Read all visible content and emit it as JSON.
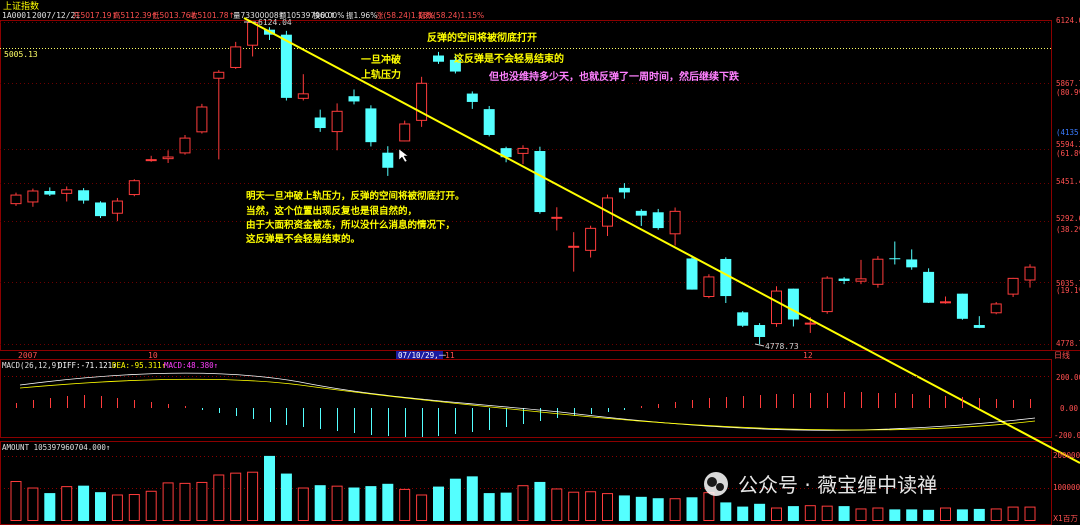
{
  "header": {
    "name": "上证指数",
    "code": "1A0001",
    "date": "2007/12/21",
    "items": [
      {
        "text": "开5017.19↑",
        "color": "#ff5050"
      },
      {
        "text": "高5112.39↑",
        "color": "#ff5050"
      },
      {
        "text": "低5013.76↑",
        "color": "#ff5050"
      },
      {
        "text": "收5101.78↑",
        "color": "#ff5050"
      },
      {
        "text": "量73300008↑",
        "color": "#e0e0e0"
      },
      {
        "text": "额105397960↑",
        "color": "#e0e0e0"
      },
      {
        "text": "换0.00%",
        "color": "#e0e0e0"
      },
      {
        "text": "振1.96%",
        "color": "#e0e0e0"
      },
      {
        "text": "涨(58.24)1.15%",
        "color": "#ff5050"
      },
      {
        "text": "指数(58.24)1.15%",
        "color": "#ff5050"
      }
    ]
  },
  "price_panel": {
    "y_labels": [
      {
        "text": "6124.0",
        "color": "#ff5050"
      },
      {
        "text": "5867.7",
        "color": "#ff5050"
      },
      {
        "text": "(80.9%)",
        "color": "#ff5050"
      },
      {
        "text": "(4135)",
        "color": "#3a7cff"
      },
      {
        "text": "5594.36",
        "color": "#ff5050"
      },
      {
        "text": "(61.8%)",
        "color": "#ff5050"
      },
      {
        "text": "5451.4",
        "color": "#ff5050"
      },
      {
        "text": "5292.6",
        "color": "#ff5050"
      },
      {
        "text": "(38.2%)",
        "color": "#ff5050"
      },
      {
        "text": "5035.7",
        "color": "#ff5050"
      },
      {
        "text": "(19.1%)",
        "color": "#ff5050"
      },
      {
        "text": "4778.7",
        "color": "#ff5050"
      }
    ],
    "ref_line_label": "5005.13",
    "high_label": "6124.04",
    "low_label": "4778.73",
    "x_labels": [
      "2007",
      "10",
      "07/10/29,一",
      "11",
      "12"
    ],
    "period_label": "日线"
  },
  "annotations": {
    "a1": "一旦冲破",
    "a2": "上轨压力",
    "a3": "反弹的空间将被彻底打开",
    "a4": "这反弹是不会轻易结束的",
    "a5": "但也没维持多少天，也就反弹了一周时间，然后继续下跌",
    "b1": "明天一旦冲破上轨压力，反弹的空间将被彻底打开。",
    "b2": "当然，这个位置出现反复也是很自然的，",
    "b3": "由于大面积资金被冻，所以没什么消息的情况下，",
    "b4": "这反弹是不会轻易结束的。"
  },
  "macd_panel": {
    "label": "MACD(26,12,9)",
    "diff": "DIFF:-71.121↑",
    "dea": "DEA:-95.311↑",
    "macd": "MACD:48.380↑",
    "y_labels": [
      "200.00",
      "0.00",
      "-200.00"
    ]
  },
  "volume_panel": {
    "label": "AMOUNT 105397960704.000↑",
    "y_labels": [
      "200000",
      "100000",
      "X1百万"
    ]
  },
  "watermark": "公众号 · 薇宝缠中读禅",
  "chart_data": {
    "type": "candlestick",
    "title": "上证指数",
    "candles": [
      {
        "o": 5363,
        "c": 5403,
        "h": 5411,
        "l": 5356
      },
      {
        "o": 5370,
        "c": 5420,
        "h": 5428,
        "l": 5352
      },
      {
        "o": 5418,
        "c": 5403,
        "h": 5433,
        "l": 5397
      },
      {
        "o": 5406,
        "c": 5425,
        "h": 5437,
        "l": 5374
      },
      {
        "o": 5421,
        "c": 5378,
        "h": 5430,
        "l": 5365
      },
      {
        "o": 5370,
        "c": 5313,
        "h": 5375,
        "l": 5305
      },
      {
        "o": 5323,
        "c": 5378,
        "h": 5389,
        "l": 5292
      },
      {
        "o": 5401,
        "c": 5463,
        "h": 5467,
        "l": 5396
      },
      {
        "o": 5551,
        "c": 5551,
        "h": 5565,
        "l": 5540
      },
      {
        "o": 5551,
        "c": 5562,
        "h": 5588,
        "l": 5535
      },
      {
        "o": 5575,
        "c": 5641,
        "h": 5652,
        "l": 5570
      },
      {
        "o": 5663,
        "c": 5771,
        "h": 5782,
        "l": 5658
      },
      {
        "o": 5887,
        "c": 5916,
        "h": 5923,
        "l": 5550
      },
      {
        "o": 5932,
        "c": 6022,
        "h": 6041,
        "l": 5928
      },
      {
        "o": 6025,
        "c": 6124,
        "h": 6124,
        "l": 5980
      },
      {
        "o": 6092,
        "c": 6071,
        "h": 6102,
        "l": 6049
      },
      {
        "o": 6071,
        "c": 5807,
        "h": 6087,
        "l": 5796
      },
      {
        "o": 5803,
        "c": 5826,
        "h": 5906,
        "l": 5796
      },
      {
        "o": 5725,
        "c": 5681,
        "h": 5758,
        "l": 5665
      },
      {
        "o": 5664,
        "c": 5753,
        "h": 5784,
        "l": 5588
      },
      {
        "o": 5814,
        "c": 5792,
        "h": 5842,
        "l": 5780
      },
      {
        "o": 5763,
        "c": 5622,
        "h": 5776,
        "l": 5604
      },
      {
        "o": 5578,
        "c": 5515,
        "h": 5605,
        "l": 5481
      },
      {
        "o": 5625,
        "c": 5700,
        "h": 5712,
        "l": 5625
      },
      {
        "o": 5711,
        "c": 5870,
        "h": 5895,
        "l": 5686
      },
      {
        "o": 5984,
        "c": 5958,
        "h": 5999,
        "l": 5949
      },
      {
        "o": 5966,
        "c": 5917,
        "h": 5984,
        "l": 5909
      },
      {
        "o": 5825,
        "c": 5790,
        "h": 5834,
        "l": 5761
      },
      {
        "o": 5760,
        "c": 5652,
        "h": 5773,
        "l": 5646
      },
      {
        "o": 5597,
        "c": 5559,
        "h": 5603,
        "l": 5538
      },
      {
        "o": 5573,
        "c": 5598,
        "h": 5609,
        "l": 5530
      },
      {
        "o": 5585,
        "c": 5330,
        "h": 5603,
        "l": 5323
      },
      {
        "o": 5310,
        "c": 5310,
        "h": 5350,
        "l": 5253
      },
      {
        "o": 5189,
        "c": 5189,
        "h": 5246,
        "l": 5081
      },
      {
        "o": 5168,
        "c": 5264,
        "h": 5273,
        "l": 5140
      },
      {
        "o": 5269,
        "c": 5391,
        "h": 5403,
        "l": 5230
      },
      {
        "o": 5431,
        "c": 5412,
        "h": 5451,
        "l": 5386
      },
      {
        "o": 5335,
        "c": 5315,
        "h": 5342,
        "l": 5272
      },
      {
        "o": 5329,
        "c": 5263,
        "h": 5343,
        "l": 5256
      },
      {
        "o": 5237,
        "c": 5335,
        "h": 5349,
        "l": 5190
      },
      {
        "o": 5136,
        "c": 5006,
        "h": 5149,
        "l": 5006
      },
      {
        "o": 4975,
        "c": 5061,
        "h": 5070,
        "l": 4970
      },
      {
        "o": 5134,
        "c": 4979,
        "h": 5141,
        "l": 4950
      },
      {
        "o": 4911,
        "c": 4855,
        "h": 4916,
        "l": 4850
      },
      {
        "o": 4858,
        "c": 4808,
        "h": 4866,
        "l": 4778
      },
      {
        "o": 4862,
        "c": 5002,
        "h": 5020,
        "l": 4850
      },
      {
        "o": 5010,
        "c": 4881,
        "h": 5010,
        "l": 4852
      },
      {
        "o": 4865,
        "c": 4868,
        "h": 4891,
        "l": 4825
      },
      {
        "o": 4912,
        "c": 5056,
        "h": 5062,
        "l": 4905
      },
      {
        "o": 5052,
        "c": 5042,
        "h": 5058,
        "l": 5029
      },
      {
        "o": 5039,
        "c": 5053,
        "h": 5130,
        "l": 5029
      },
      {
        "o": 5026,
        "c": 5135,
        "h": 5146,
        "l": 5014
      },
      {
        "o": 5137,
        "c": 5133,
        "h": 5207,
        "l": 5111
      },
      {
        "o": 5132,
        "c": 5099,
        "h": 5174,
        "l": 5089
      },
      {
        "o": 5080,
        "c": 4951,
        "h": 5095,
        "l": 4950
      },
      {
        "o": 4956,
        "c": 4957,
        "h": 4977,
        "l": 4947
      },
      {
        "o": 4989,
        "c": 4884,
        "h": 4989,
        "l": 4880
      },
      {
        "o": 4858,
        "c": 4846,
        "h": 4895,
        "l": 4845
      },
      {
        "o": 4907,
        "c": 4948,
        "h": 4954,
        "l": 4903
      },
      {
        "o": 4985,
        "c": 5055,
        "h": 5055,
        "l": 4975
      },
      {
        "o": 5044,
        "c": 5102,
        "h": 5112,
        "l": 5014
      }
    ],
    "amount": [
      86,
      72,
      60,
      75,
      76,
      62,
      57,
      58,
      65,
      83,
      82,
      84,
      100,
      104,
      106,
      140,
      102,
      72,
      77,
      76,
      72,
      75,
      80,
      69,
      57,
      74,
      91,
      96,
      60,
      61,
      77,
      84,
      70,
      63,
      64,
      60,
      55,
      52,
      49,
      49,
      51,
      62,
      40,
      31,
      37,
      29,
      32,
      34,
      33,
      32,
      27,
      29,
      25,
      25,
      24,
      29,
      25,
      26,
      27,
      31,
      31
    ],
    "macd_bars": [
      5,
      8,
      10,
      12,
      13,
      12,
      10,
      8,
      6,
      4,
      2,
      -2,
      -5,
      -8,
      -11,
      -14,
      -17,
      -19,
      -21,
      -23,
      -25,
      -27,
      -28,
      -29,
      -29,
      -28,
      -26,
      -24,
      -22,
      -19,
      -16,
      -13,
      -10,
      -8,
      -6,
      -4,
      -2,
      2,
      4,
      6,
      8,
      10,
      11,
      12,
      13,
      14,
      14,
      15,
      15,
      16,
      16,
      15,
      15,
      14,
      13,
      12,
      11,
      10,
      9,
      8,
      9
    ],
    "x_labels": [
      "2007",
      "10",
      "07/10/29,一",
      "11",
      "12"
    ],
    "y_range": [
      4760,
      6160
    ]
  }
}
